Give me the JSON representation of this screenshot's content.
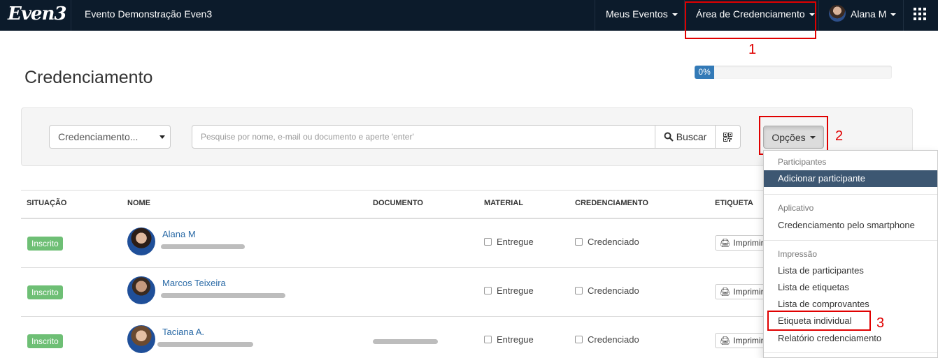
{
  "navbar": {
    "logo": "Even3",
    "event_title": "Evento Demonstração Even3",
    "my_events": "Meus Eventos",
    "credential_area": "Área de Credenciamento",
    "user_name": "Alana M"
  },
  "annotations": [
    "1",
    "2",
    "3"
  ],
  "page": {
    "title": "Credenciamento",
    "progress_label": "0%",
    "progress_fraction": 0.1
  },
  "filters": {
    "select_value": "Credenciamento...",
    "search_placeholder": "Pesquise por nome, e-mail ou documento e aperte 'enter'",
    "search_button": "Buscar",
    "options_button": "Opções"
  },
  "table": {
    "headers": [
      "SITUAÇÃO",
      "NOME",
      "DOCUMENTO",
      "MATERIAL",
      "CREDENCIAMENTO",
      "ETIQUETA"
    ],
    "rows": [
      {
        "status": "Inscrito",
        "name": "Alana M",
        "material": "Entregue",
        "credential": "Credenciado",
        "print": "Imprimir"
      },
      {
        "status": "Inscrito",
        "name": "Marcos Teixeira",
        "material": "Entregue",
        "credential": "Credenciado",
        "print": "Imprimir"
      },
      {
        "status": "Inscrito",
        "name": "Taciana A.",
        "material": "Entregue",
        "credential": "Credenciado",
        "print": "Imprimir"
      }
    ]
  },
  "dropdown": {
    "sections": [
      {
        "header": "Participantes",
        "items": [
          "Adicionar participante"
        ]
      },
      {
        "header": "Aplicativo",
        "items": [
          "Credenciamento pelo smartphone"
        ]
      },
      {
        "header": "Impressão",
        "items": [
          "Lista de participantes",
          "Lista de etiquetas",
          "Lista de comprovantes",
          "Etiqueta individual",
          "Relatório credenciamento"
        ]
      }
    ]
  },
  "colors": {
    "navbar": "#0c1b2b",
    "accent": "#337ab7",
    "status_green": "#6ebf75",
    "annotation_red": "#e00000"
  }
}
